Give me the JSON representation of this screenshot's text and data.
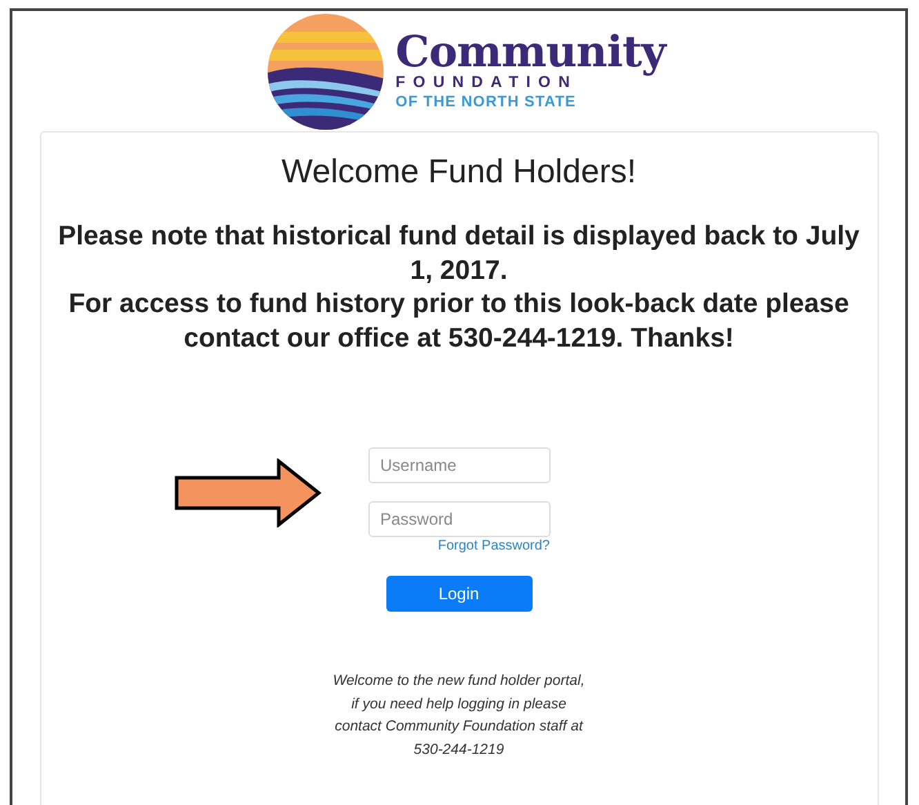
{
  "logo": {
    "name": "Community",
    "line_2": "FOUNDATION",
    "line_3": "OF THE NORTH STATE"
  },
  "title": "Welcome Fund Holders!",
  "notice": [
    "Please note that **historical fund detail is displayed back to July 1, 2017**.",
    "For access to fund history prior to this look-back date please contact our office at 530-244-1219. Thanks!"
  ],
  "form": {
    "username": {
      "placeholder": "Username"
    },
    "password": {
      "placeholder": "Password"
    },
    "forgot_link": "Forgot Password?",
    "login_button": "Login"
  },
  "footer_note": "Welcome to the new fund holder portal, if you need help logging in please contact Community Foundation staff at 530-244-1219"
}
